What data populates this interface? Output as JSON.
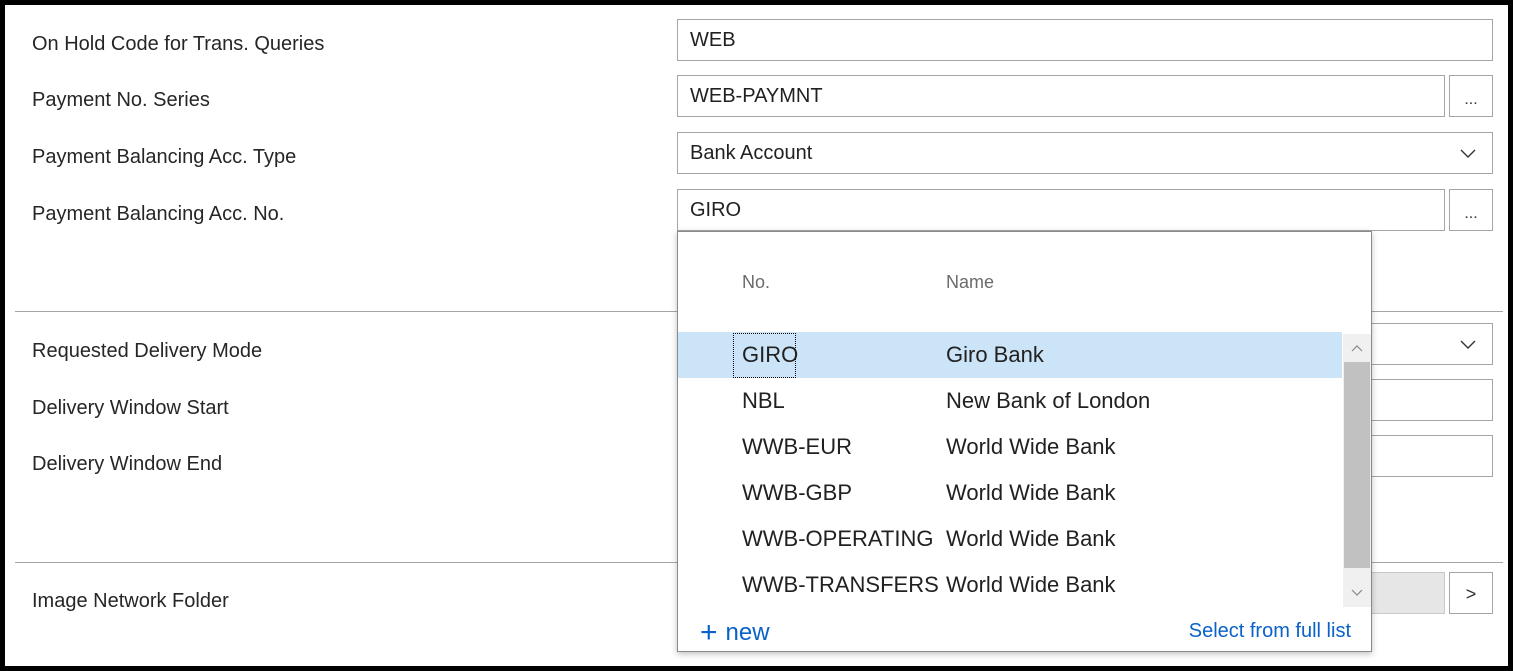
{
  "fields": {
    "on_hold_code": {
      "label": "On Hold Code for Trans. Queries",
      "value": "WEB"
    },
    "payment_no_series": {
      "label": "Payment No. Series",
      "value": "WEB-PAYMNT",
      "assist": "..."
    },
    "payment_bal_acc_type": {
      "label": "Payment Balancing Acc. Type",
      "value": "Bank Account"
    },
    "payment_bal_acc_no": {
      "label": "Payment Balancing Acc. No.",
      "value": "GIRO",
      "assist": "..."
    },
    "requested_delivery_mode": {
      "label": "Requested Delivery Mode"
    },
    "delivery_window_start": {
      "label": "Delivery Window Start"
    },
    "delivery_window_end": {
      "label": "Delivery Window End"
    },
    "image_network_folder": {
      "label": "Image Network Folder",
      "nav": ">"
    }
  },
  "lookup": {
    "columns": {
      "no": "No.",
      "name": "Name"
    },
    "rows": [
      {
        "no": "GIRO",
        "name": "Giro Bank",
        "selected": true
      },
      {
        "no": "NBL",
        "name": "New Bank of London"
      },
      {
        "no": "WWB-EUR",
        "name": "World Wide Bank"
      },
      {
        "no": "WWB-GBP",
        "name": "World Wide Bank"
      },
      {
        "no": "WWB-OPERATING",
        "name": "World Wide Bank"
      },
      {
        "no": "WWB-TRANSFERS",
        "name": "World Wide Bank"
      }
    ],
    "new_label": "new",
    "new_icon": "+",
    "full_list_label": "Select from full list"
  },
  "colors": {
    "accent": "#0a61c9",
    "selected_row": "#cce4f7"
  }
}
